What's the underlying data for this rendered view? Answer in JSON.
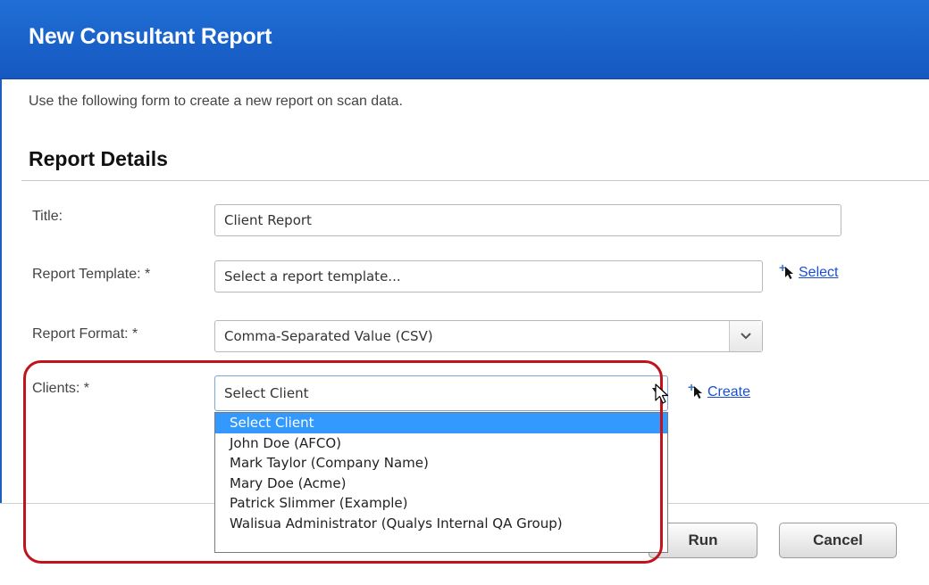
{
  "header": {
    "title": "New Consultant Report"
  },
  "intro_text": "Use the following form to create a new report on scan data.",
  "section": {
    "title": "Report Details"
  },
  "form": {
    "title": {
      "label": "Title:",
      "value": "Client Report"
    },
    "template": {
      "label": "Report Template: *",
      "value": "Select a report template...",
      "action_label": "Select",
      "action_icon": "plus-cursor-icon"
    },
    "format": {
      "label": "Report Format: *",
      "value": "Comma-Separated Value (CSV)",
      "dropdown_icon": "chevron-down-icon"
    },
    "clients": {
      "label": "Clients: *",
      "value": "Select Client",
      "action_label": "Create",
      "action_icon": "plus-cursor-icon",
      "options": [
        "Select Client",
        "John Doe (AFCO)",
        "Mark Taylor (Company Name)",
        "Mary Doe (Acme)",
        "Patrick Slimmer (Example)",
        "Walisua Administrator (Qualys Internal QA Group)"
      ],
      "selected_index": 0
    }
  },
  "buttons": {
    "run": "Run",
    "cancel": "Cancel"
  },
  "colors": {
    "header_bg": "#1a63cc",
    "link": "#1a4fd4",
    "selected_option": "#3399ff",
    "annotation": "#c0141d"
  }
}
